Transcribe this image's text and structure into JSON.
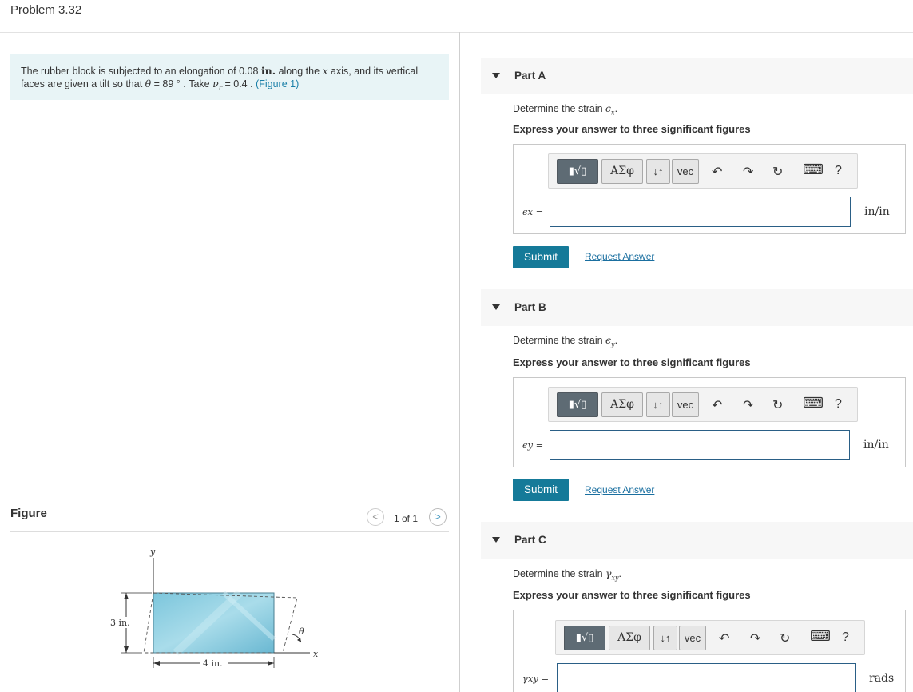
{
  "header": {
    "title": "Problem 3.32"
  },
  "problem": {
    "text_a": "The rubber block is subjected to an elongation of 0.08 ",
    "unit_in": "in.",
    "text_b": " along the ",
    "axis_var": "x",
    "text_c": " axis, and its vertical",
    "text_d": "faces are given a tilt so that ",
    "theta_sym": "θ",
    "text_e": " = 89 ° . Take ",
    "nu_sym": "ν",
    "nu_sub": "r",
    "text_f": " = 0.4 . ",
    "figure_link": "(Figure 1)"
  },
  "figure": {
    "label": "Figure",
    "pager": "1 of 1",
    "prev": "<",
    "next": ">",
    "y_axis": "y",
    "x_axis": "x",
    "height_label": "3 in.",
    "width_label": "4 in.",
    "angle_label": "θ"
  },
  "parts": [
    {
      "label": "Part A",
      "question_text": "Determine the strain ",
      "question_sym": "ϵ",
      "question_sub": "x",
      "instruction": "Express your answer to three significant figures",
      "answer_label": "ϵx =",
      "unit": "in/in",
      "submit": "Submit",
      "request": "Request Answer"
    },
    {
      "label": "Part B",
      "question_text": "Determine the strain ",
      "question_sym": "ϵ",
      "question_sub": "y",
      "instruction": "Express your answer to three significant figures",
      "answer_label": "ϵy =",
      "unit": "in/in",
      "submit": "Submit",
      "request": "Request Answer"
    },
    {
      "label": "Part C",
      "question_text": "Determine the strain ",
      "question_sym": "γ",
      "question_sub": "xy",
      "instruction": "Express your answer to three significant figures",
      "answer_label": "γxy =",
      "unit": "rads"
    }
  ],
  "toolbar": {
    "templates": "▮√▯",
    "greek": "ΑΣφ",
    "arrows": "↓↑",
    "vec": "vec",
    "undo": "↶",
    "redo": "↷",
    "reset": "↻",
    "keyboard": "⌨",
    "help": "?"
  }
}
